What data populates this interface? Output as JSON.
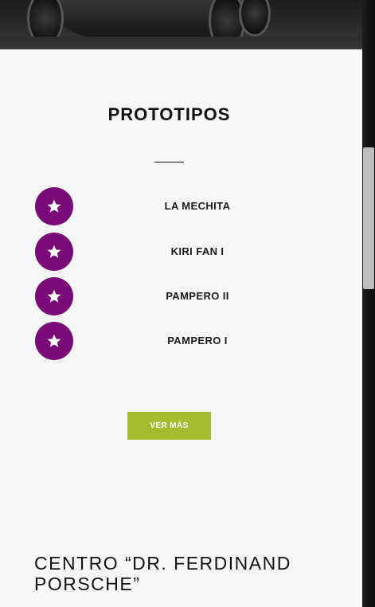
{
  "hero": {
    "image": "vehicle-photo"
  },
  "prototipos": {
    "title": "PROTOTIPOS",
    "icon": "star-icon",
    "accent_color": "#7a0a77",
    "items": [
      {
        "label": "LA MECHITA"
      },
      {
        "label": "KIRI FAN I"
      },
      {
        "label": "PAMPERO II"
      },
      {
        "label": "PAMPERO I"
      }
    ],
    "more_button": {
      "label": "VER MÁS",
      "color": "#a3bd2e"
    }
  },
  "next_section": {
    "title_line1": "CENTRO “DR. FERDINAND",
    "title_line2": "PORSCHE”"
  }
}
